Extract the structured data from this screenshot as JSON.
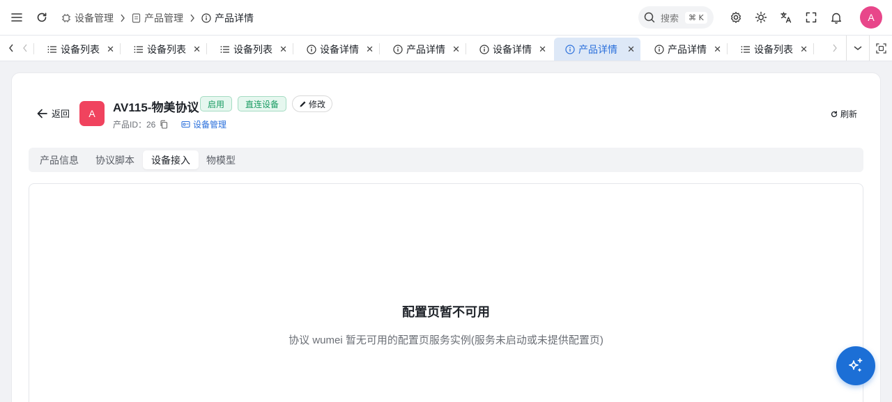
{
  "header": {
    "breadcrumbs": [
      {
        "label": "设备管理"
      },
      {
        "label": "产品管理"
      },
      {
        "label": "产品详情"
      }
    ],
    "search": {
      "placeholder": "搜索",
      "shortcut": "⌘ K"
    },
    "user_avatar": "A"
  },
  "tabs": [
    {
      "label": "设备列表",
      "icon": "list-icon"
    },
    {
      "label": "设备列表",
      "icon": "list-icon"
    },
    {
      "label": "设备列表",
      "icon": "list-icon"
    },
    {
      "label": "设备详情",
      "icon": "info-icon"
    },
    {
      "label": "产品详情",
      "icon": "info-icon"
    },
    {
      "label": "设备详情",
      "icon": "info-icon"
    },
    {
      "label": "产品详情",
      "icon": "info-icon",
      "active": true
    },
    {
      "label": "产品详情",
      "icon": "info-icon"
    },
    {
      "label": "设备列表",
      "icon": "list-icon"
    }
  ],
  "product": {
    "back_label": "返回",
    "avatar": "A",
    "name": "AV115-物美协议",
    "status_badge": "启用",
    "type_badge": "直连设备",
    "edit_label": "修改",
    "id_label": "产品ID：26",
    "device_link": "设备管理",
    "refresh_label": "刷新"
  },
  "subtabs": [
    {
      "label": "产品信息"
    },
    {
      "label": "协议脚本"
    },
    {
      "label": "设备接入",
      "active": true
    },
    {
      "label": "物模型"
    }
  ],
  "empty_state": {
    "title": "配置页暂不可用",
    "description": "协议 wumei 暂无可用的配置页服务实例(服务未启动或未提供配置页)"
  },
  "colors": {
    "accent": "#2a6fdb",
    "active_tab_bg": "#dde8f7",
    "badge_green": "#1a9c63",
    "product_avatar": "#f0435e",
    "user_avatar": "#e8468a",
    "fab": "#1c6fd6"
  }
}
